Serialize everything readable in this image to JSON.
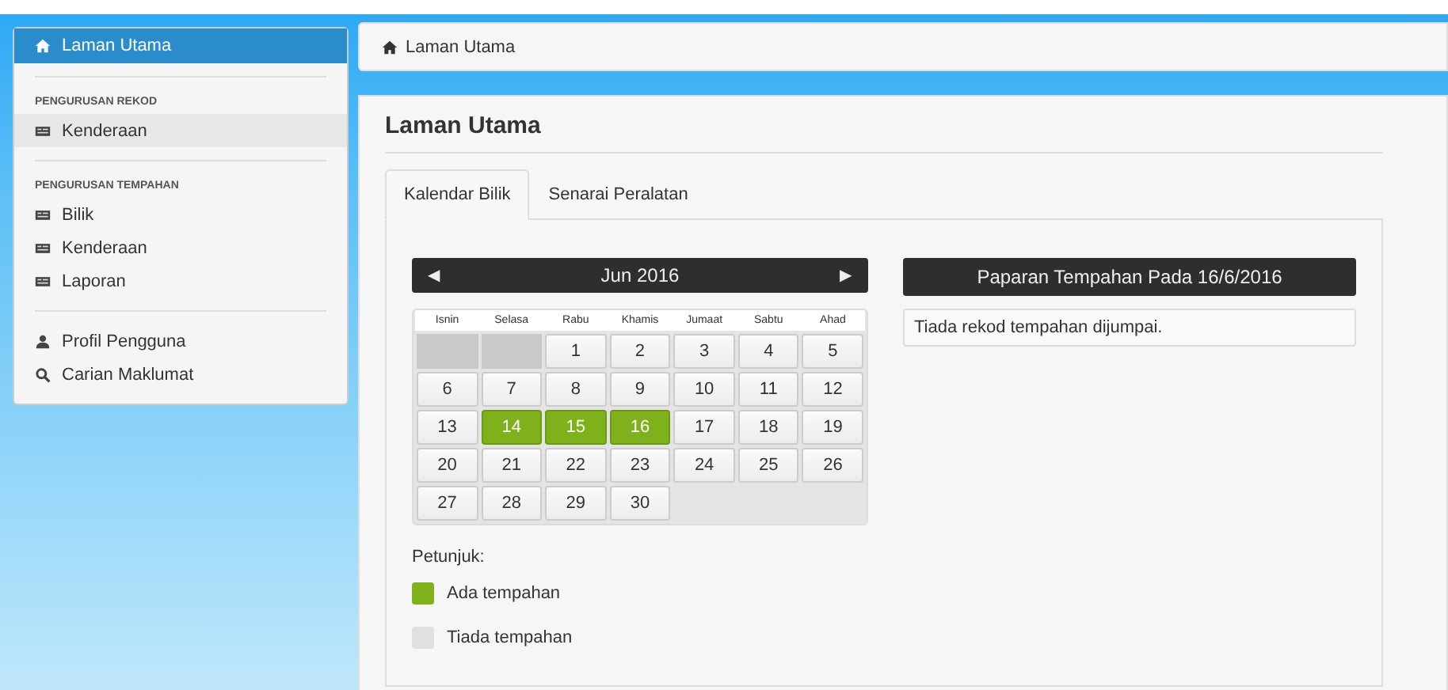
{
  "sidebar": {
    "groups": [
      {
        "items": [
          {
            "label": "Laman Utama",
            "kind": "home",
            "selected": true,
            "hover": false
          }
        ]
      },
      {
        "heading": "PENGURUSAN REKOD",
        "items": [
          {
            "label": "Kenderaan",
            "kind": "record",
            "selected": false,
            "hover": true
          }
        ]
      },
      {
        "heading": "PENGURUSAN TEMPAHAN",
        "items": [
          {
            "label": "Bilik",
            "kind": "record",
            "selected": false,
            "hover": false
          },
          {
            "label": "Kenderaan",
            "kind": "record",
            "selected": false,
            "hover": false
          },
          {
            "label": "Laporan",
            "kind": "record",
            "selected": false,
            "hover": false
          }
        ]
      },
      {
        "items": [
          {
            "label": "Profil Pengguna",
            "kind": "profile",
            "selected": false,
            "hover": false
          },
          {
            "label": "Carian Maklumat",
            "kind": "search",
            "selected": false,
            "hover": false
          }
        ]
      }
    ]
  },
  "breadcrumb": "Laman Utama",
  "page_title": "Laman Utama",
  "tabs": [
    {
      "label": "Kalendar Bilik",
      "selected": true
    },
    {
      "label": "Senarai Peralatan",
      "selected": false
    }
  ],
  "calendar": {
    "prev": "◀",
    "next": "▶",
    "month": "Jun 2016",
    "weekdays": [
      "Isnin",
      "Selasa",
      "Rabu",
      "Khamis",
      "Jumaat",
      "Sabtu",
      "Ahad"
    ],
    "weeks": [
      [
        {
          "kind": "empty"
        },
        {
          "kind": "empty"
        },
        {
          "day": "1",
          "booked": false
        },
        {
          "day": "2",
          "booked": false
        },
        {
          "day": "3",
          "booked": false
        },
        {
          "day": "4",
          "booked": false
        },
        {
          "day": "5",
          "booked": false
        }
      ],
      [
        {
          "day": "6",
          "booked": false
        },
        {
          "day": "7",
          "booked": false
        },
        {
          "day": "8",
          "booked": false
        },
        {
          "day": "9",
          "booked": false
        },
        {
          "day": "10",
          "booked": false
        },
        {
          "day": "11",
          "booked": false
        },
        {
          "day": "12",
          "booked": false
        }
      ],
      [
        {
          "day": "13",
          "booked": false
        },
        {
          "day": "14",
          "booked": true
        },
        {
          "day": "15",
          "booked": true
        },
        {
          "day": "16",
          "booked": true
        },
        {
          "day": "17",
          "booked": false
        },
        {
          "day": "18",
          "booked": false
        },
        {
          "day": "19",
          "booked": false
        }
      ],
      [
        {
          "day": "20",
          "booked": false
        },
        {
          "day": "21",
          "booked": false
        },
        {
          "day": "22",
          "booked": false
        },
        {
          "day": "23",
          "booked": false
        },
        {
          "day": "24",
          "booked": false
        },
        {
          "day": "25",
          "booked": false
        },
        {
          "day": "26",
          "booked": false
        }
      ],
      [
        {
          "day": "27",
          "booked": false
        },
        {
          "day": "28",
          "booked": false
        },
        {
          "day": "29",
          "booked": false
        },
        {
          "day": "30",
          "booked": false
        }
      ]
    ]
  },
  "legend": {
    "title": "Petunjuk:",
    "items": [
      {
        "label": "Ada tempahan",
        "color": "#7fb21a"
      },
      {
        "label": "Tiada tempahan",
        "color": "#e0e0e0"
      }
    ]
  },
  "bookings": {
    "title": "Paparan Tempahan Pada 16/6/2016",
    "message": "Tiada rekod tempahan dijumpai."
  }
}
